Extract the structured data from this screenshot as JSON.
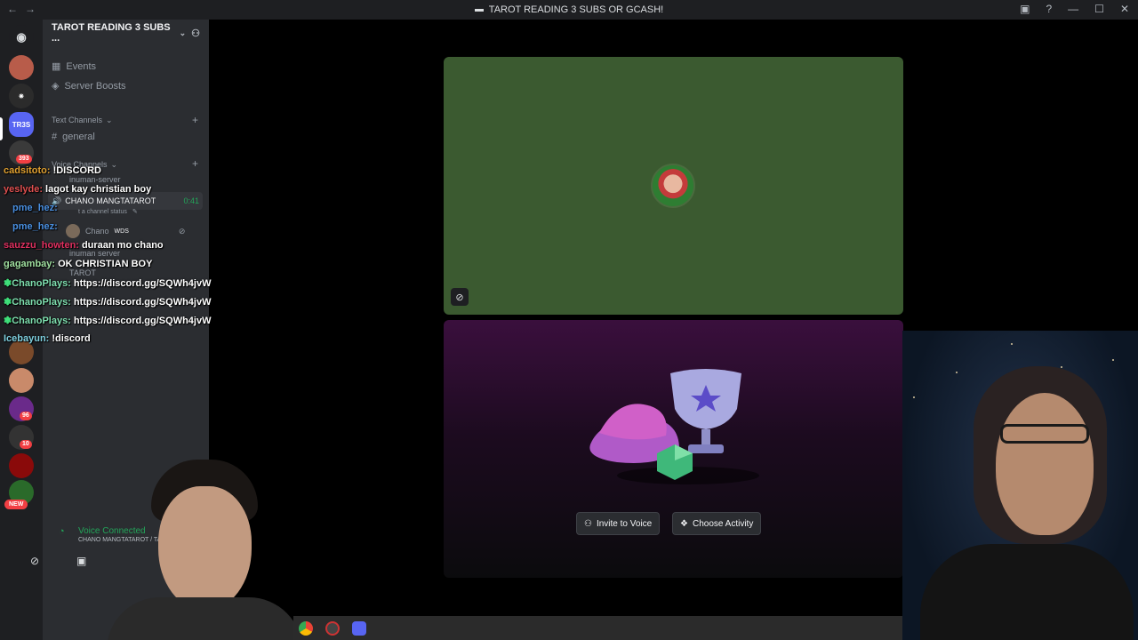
{
  "window": {
    "title": "TAROT READING 3 SUBS OR GCASH!"
  },
  "server": {
    "name": "TAROT READING 3 SUBS ...",
    "events_label": "Events",
    "boosts_label": "Server Boosts",
    "text_channels_label": "Text Channels",
    "general_label": "general",
    "voice_channels_label": "Voice Channels",
    "voice_channel_1": "inuman-server",
    "vc_user_name": "CHANO MANGTATAROT",
    "vc_user_time": "0:41",
    "vc_status_placeholder": "t a channel status",
    "vc_user2_name": "Chano",
    "vc_user2_tag": "WDS",
    "voice_channel_2": "inuman server",
    "voice_channel_3": "TAROT",
    "voice_connected_label": "Voice Connected",
    "voice_connected_sub": "CHANO MANGTATAROT / TAROT"
  },
  "rail": {
    "badges": [
      "393",
      "96",
      "10"
    ],
    "new_label": "NEW"
  },
  "chat": [
    {
      "user": "cadsitoto:",
      "text": "!DISCORD",
      "color": "#e0a030"
    },
    {
      "user": "yeslyde:",
      "text": "lagot kay christian boy",
      "color": "#e05050"
    },
    {
      "user": "pme_hez:",
      "text": "",
      "color": "#4a90e2"
    },
    {
      "user": "pme_hez:",
      "text": "",
      "color": "#4a90e2"
    },
    {
      "user": "sauzzu_howten:",
      "text": "duraan mo chano",
      "color": "#e03060"
    },
    {
      "user": "gagambay:",
      "text": "OK CHRISTIAN BOY",
      "color": "#a0e0a0"
    },
    {
      "user": "ChanoPlays:",
      "text": "https://discord.gg/SQWh4jvW",
      "color": "#7fe0b0"
    },
    {
      "user": "ChanoPlays:",
      "text": "https://discord.gg/SQWh4jvW",
      "color": "#7fe0b0"
    },
    {
      "user": "ChanoPlays:",
      "text": "https://discord.gg/SQWh4jvW",
      "color": "#7fe0b0"
    },
    {
      "user": "Icebayun:",
      "text": "!discord",
      "color": "#7fd0e0"
    }
  ],
  "activity": {
    "invite_label": "Invite to Voice",
    "choose_label": "Choose Activity"
  },
  "colors": {
    "tile_green": "#3b5a30",
    "voice_green": "#23a55a",
    "badge_red": "#f23f43"
  }
}
